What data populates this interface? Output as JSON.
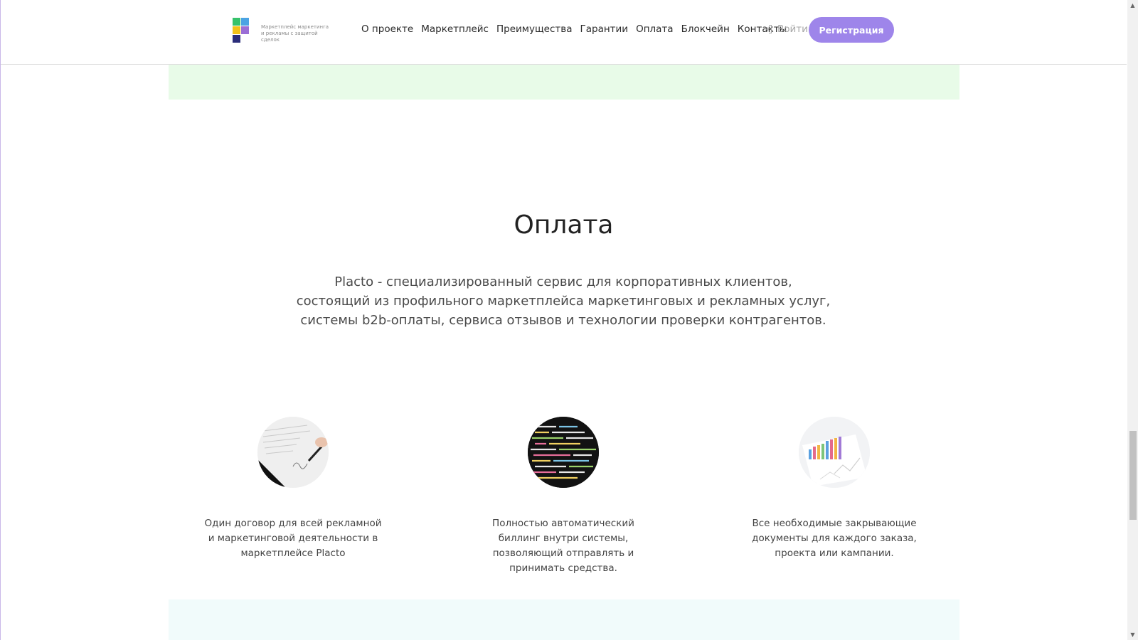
{
  "header": {
    "logo_tagline": "Маркетплейс маркетинга и рекламы с защитой сделок",
    "nav": [
      "О проекте",
      "Маркетплейс",
      "Преимущества",
      "Гарантии",
      "Оплата",
      "Блокчейн",
      "Контакты"
    ],
    "login_label": "Войти",
    "register_label": "Регистрация"
  },
  "section": {
    "title": "Оплата",
    "description_lines": [
      "Placto - специализированный сервис для корпоративных клиентов,",
      "состоящий из профильного маркетплейса маркетинговых и рекламных услуг,",
      "системы b2b-оплаты, сервиса отзывов и технологии проверки контрагентов."
    ],
    "features": [
      {
        "icon": "contract-signing-photo",
        "text": "Один договор для всей рекламной и маркетинговой деятельности в маркетплейсе Placto"
      },
      {
        "icon": "code-screen-photo",
        "text": "Полностью автоматический биллинг внутри системы, позволяющий отправлять и принимать средства."
      },
      {
        "icon": "charts-documents-photo",
        "text": "Все необходимые закрывающие документы для каждого заказа, проекта или кампании."
      }
    ]
  },
  "colors": {
    "accent": "#9e85ea",
    "green_band": "#e8fbe8",
    "blue_band": "#f1fbfb"
  }
}
